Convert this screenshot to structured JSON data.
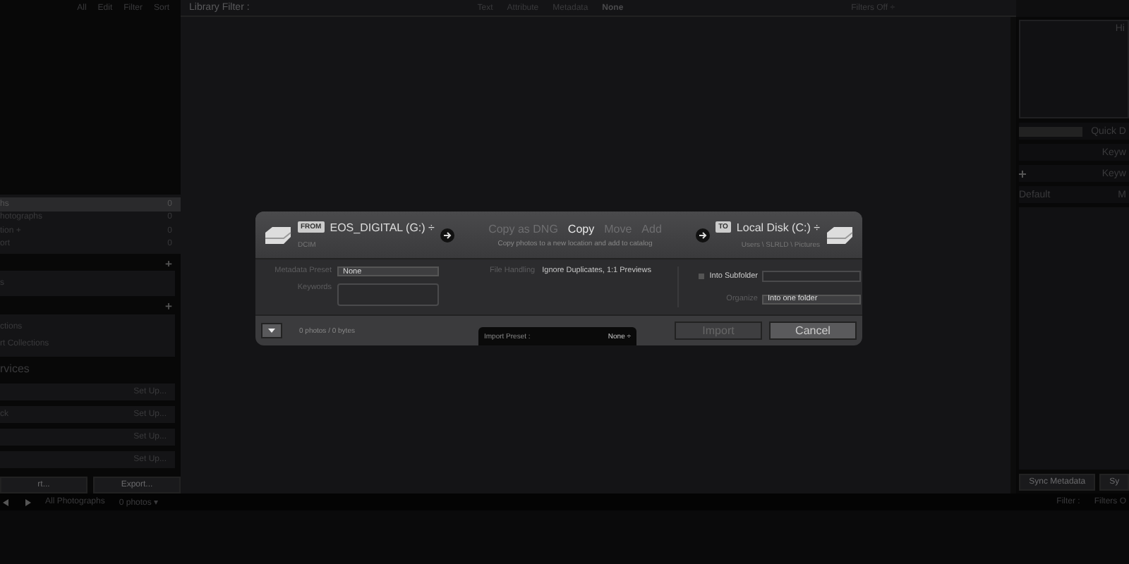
{
  "top_bar": {
    "left_labels": [
      "All",
      "Edit",
      "Filter",
      "Sort"
    ],
    "title": "Library Filter :",
    "filters": [
      {
        "label": "Text",
        "selected": false
      },
      {
        "label": "Attribute",
        "selected": false
      },
      {
        "label": "Metadata",
        "selected": false
      },
      {
        "label": "None",
        "selected": true
      }
    ],
    "filters_status": "Filters Off ÷"
  },
  "left_panel": {
    "catalog": [
      {
        "label": "hs",
        "count": "0",
        "selected": true
      },
      {
        "label": "hotographs",
        "count": "0",
        "selected": false
      },
      {
        "label": "tion +",
        "count": "0",
        "selected": false
      },
      {
        "label": "ort",
        "count": "0",
        "selected": false
      }
    ],
    "folders_item": "s",
    "collections": [
      "ctions",
      "rt Collections"
    ],
    "services_header": "rvices",
    "services": [
      {
        "action": "Set Up..."
      },
      {
        "label": "ck",
        "action": "Set Up..."
      },
      {
        "action": "Set Up..."
      },
      {
        "action": "Set Up..."
      }
    ],
    "buttons": [
      "rt...",
      "Export..."
    ]
  },
  "right_panel": {
    "histogram_title": "Hi",
    "quick_develop": "Quick D",
    "keywording": "Keyw",
    "keyword_list": "Keyw",
    "metadata_preset": "Default",
    "metadata": "M",
    "buttons": [
      "Sync Metadata",
      "Sy"
    ]
  },
  "filmstrip": {
    "source": "All Photographs",
    "count": "0 photos ▾",
    "filter_label": "Filter :",
    "filter_value": "Filters O"
  },
  "import_dialog": {
    "from": {
      "badge": "FROM",
      "source": "EOS_DIGITAL (G:) ÷",
      "path": "DCIM"
    },
    "modes": [
      {
        "label": "Copy as DNG",
        "selected": false
      },
      {
        "label": "Copy",
        "selected": true
      },
      {
        "label": "Move",
        "selected": false
      },
      {
        "label": "Add",
        "selected": false
      }
    ],
    "mode_description": "Copy photos to a new location and add to catalog",
    "to": {
      "badge": "TO",
      "destination": "Local Disk (C:) ÷",
      "path": "Users \\ SLRLD \\ Pictures"
    },
    "metadata_preset": {
      "label": "Metadata Preset",
      "value": "None"
    },
    "keywords_label": "Keywords",
    "file_handling": {
      "label": "File Handling",
      "value": "Ignore Duplicates, 1:1 Previews"
    },
    "into_subfolder": {
      "label": "Into Subfolder",
      "checked": false
    },
    "organize": {
      "label": "Organize",
      "value": "Into one folder"
    },
    "summary": "0 photos / 0 bytes",
    "import_preset": {
      "label": "Import Preset :",
      "value": "None ÷"
    },
    "import_button": {
      "label": "Import",
      "disabled": true
    },
    "cancel_button": "Cancel"
  }
}
